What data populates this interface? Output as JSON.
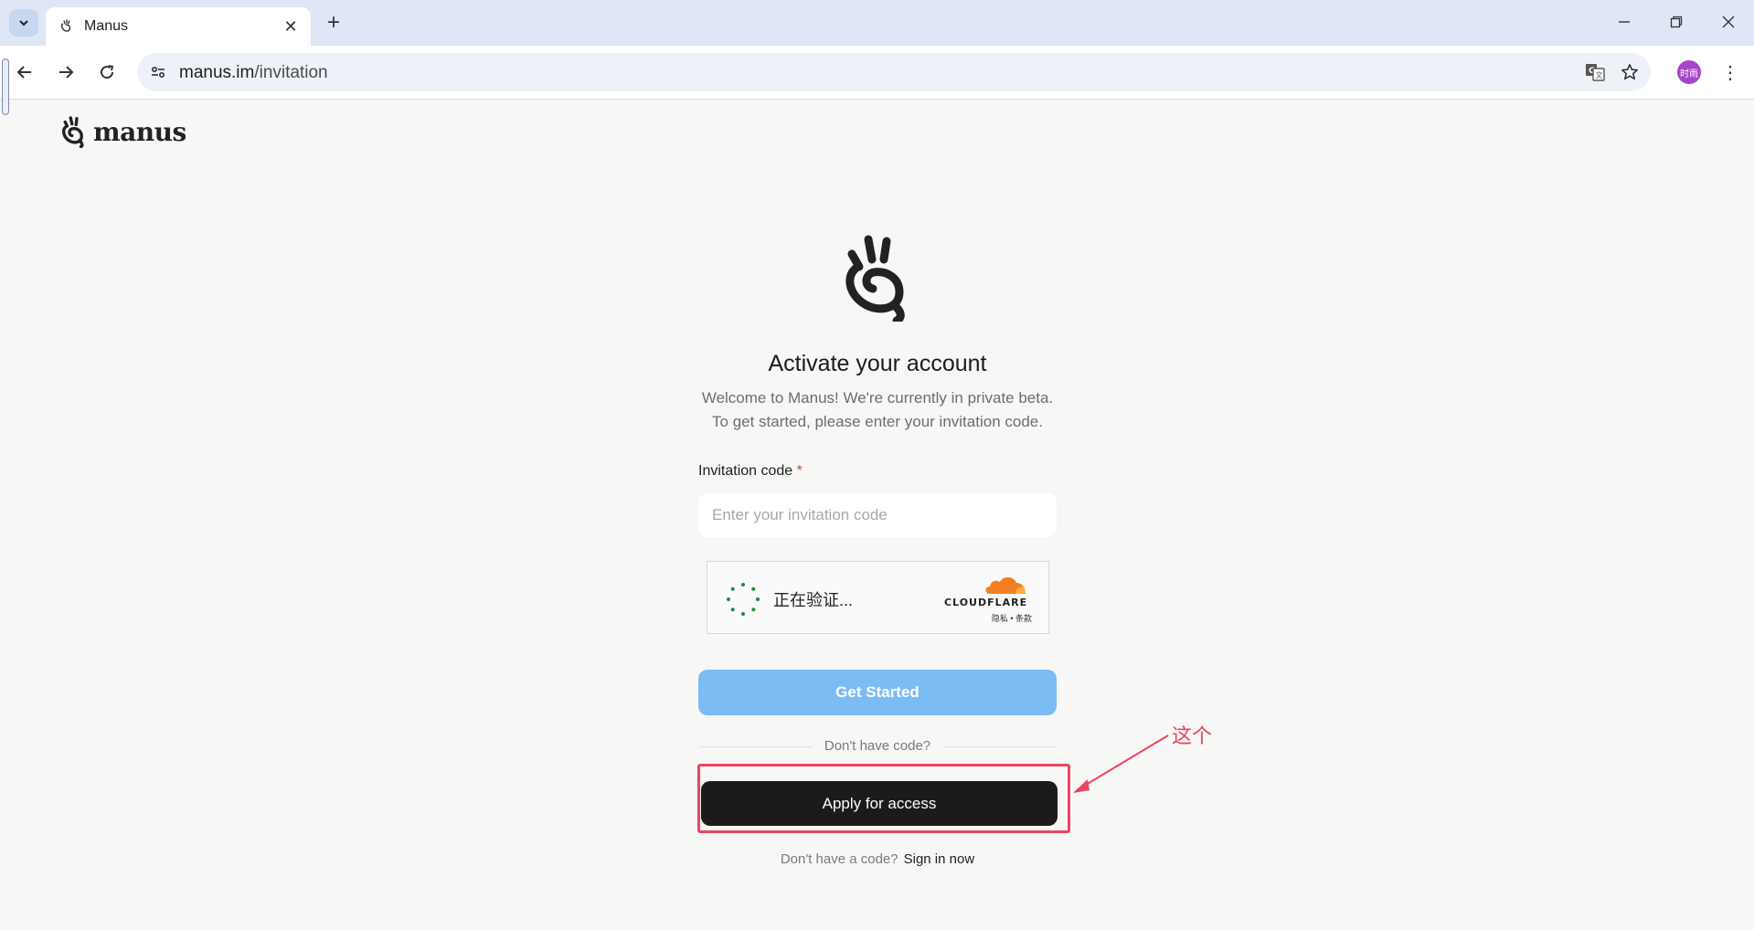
{
  "browser": {
    "tab_title": "Manus",
    "url_host": "manus.im",
    "url_path": "/invitation",
    "avatar_text": "时雨",
    "new_tab_symbol": "+",
    "close_symbol": "✕",
    "menu_symbol": "⋮"
  },
  "brand": {
    "name": "manus"
  },
  "card": {
    "title": "Activate your account",
    "subtitle_line1": "Welcome to Manus! We're currently in private beta.",
    "subtitle_line2": "To get started, please enter your invitation code."
  },
  "form": {
    "label": "Invitation code",
    "required_mark": "*",
    "placeholder": "Enter your invitation code",
    "value": ""
  },
  "captcha": {
    "status": "正在验证...",
    "provider": "CLOUDFLARE",
    "links": "隐私 • 条款"
  },
  "buttons": {
    "get_started": "Get Started",
    "divider_text": "Don't have code?",
    "apply": "Apply for access"
  },
  "footer": {
    "prompt": "Don't have a code?",
    "link": "Sign in now"
  },
  "annotation": {
    "text": "这个"
  },
  "colors": {
    "accent_disabled": "#7bbcf4",
    "primary_dark": "#1b1b1b",
    "annotation": "#e8465e",
    "cloudflare_orange": "#f38020"
  }
}
